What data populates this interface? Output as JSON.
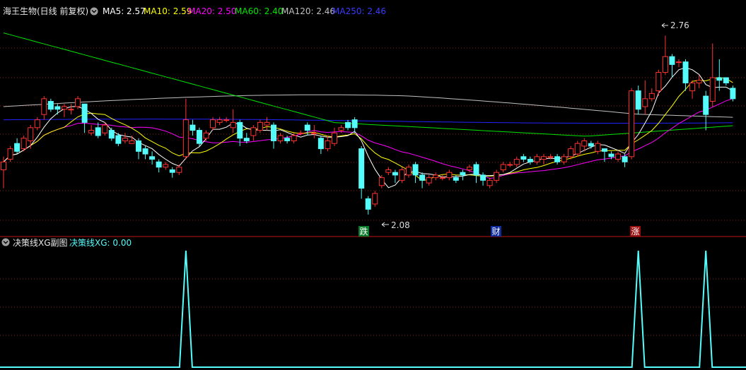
{
  "colors": {
    "up": "#ff3232",
    "down": "#54fcfc",
    "grid": "#8b1a1a",
    "ma5": "#ffffff",
    "ma10": "#ffff00",
    "ma20": "#ff00ff",
    "ma60": "#00e600",
    "ma120": "#c0c0c0",
    "ma250": "#2222ff",
    "xg": "#54fcfc"
  },
  "header": {
    "title": "海王生物(日线 前复权)",
    "menu_icon": "chevron-down-icon",
    "ma5": "MA5: 2.57",
    "ma10": "MA10: 2.59",
    "ma20": "MA20: 2.50",
    "ma60": "MA60: 2.40",
    "ma120": "MA120: 2.46",
    "ma250": "MA250: 2.46"
  },
  "annotations": {
    "high": "2.76",
    "low": "2.08",
    "signal_fall": "跌",
    "signal_wealth": "财",
    "signal_rise": "涨"
  },
  "sub": {
    "title": "决策线XG副图",
    "menu_icon": "chevron-down-icon",
    "value": "决策线XG: 0.00"
  },
  "chart_data": {
    "type": "candlestick",
    "ylim": [
      2.05,
      2.82
    ],
    "candles": [
      [
        2.25,
        2.28,
        2.18,
        2.3
      ],
      [
        2.29,
        2.33,
        2.28,
        2.34
      ],
      [
        2.35,
        2.32,
        2.31,
        2.37
      ],
      [
        2.33,
        2.37,
        2.32,
        2.38
      ],
      [
        2.36,
        2.41,
        2.33,
        2.42
      ],
      [
        2.41,
        2.44,
        2.4,
        2.45
      ],
      [
        2.46,
        2.52,
        2.44,
        2.53
      ],
      [
        2.51,
        2.48,
        2.47,
        2.52
      ],
      [
        2.49,
        2.48,
        2.46,
        2.5
      ],
      [
        2.48,
        2.49,
        2.45,
        2.5
      ],
      [
        2.48,
        2.48,
        2.46,
        2.5
      ],
      [
        2.49,
        2.52,
        2.48,
        2.53
      ],
      [
        2.5,
        2.43,
        2.39,
        2.5
      ],
      [
        2.39,
        2.4,
        2.38,
        2.42
      ],
      [
        2.41,
        2.38,
        2.37,
        2.43
      ],
      [
        2.39,
        2.42,
        2.38,
        2.43
      ],
      [
        2.4,
        2.37,
        2.36,
        2.41
      ],
      [
        2.38,
        2.35,
        2.34,
        2.39
      ],
      [
        2.36,
        2.37,
        2.35,
        2.39
      ],
      [
        2.35,
        2.36,
        2.35,
        2.38
      ],
      [
        2.36,
        2.32,
        2.29,
        2.37
      ],
      [
        2.33,
        2.31,
        2.29,
        2.34
      ],
      [
        2.3,
        2.29,
        2.27,
        2.32
      ],
      [
        2.28,
        2.26,
        2.24,
        2.29
      ],
      [
        2.26,
        2.27,
        2.25,
        2.28
      ],
      [
        2.25,
        2.24,
        2.22,
        2.26
      ],
      [
        2.24,
        2.26,
        2.23,
        2.27
      ],
      [
        2.3,
        2.44,
        2.29,
        2.52
      ],
      [
        2.42,
        2.4,
        2.38,
        2.44
      ],
      [
        2.4,
        2.35,
        2.34,
        2.41
      ],
      [
        2.37,
        2.39,
        2.36,
        2.4
      ],
      [
        2.41,
        2.44,
        2.4,
        2.45
      ],
      [
        2.43,
        2.44,
        2.42,
        2.45
      ],
      [
        2.44,
        2.44,
        2.43,
        2.45
      ],
      [
        2.41,
        2.43,
        2.39,
        2.48
      ],
      [
        2.43,
        2.37,
        2.34,
        2.44
      ],
      [
        2.37,
        2.36,
        2.35,
        2.39
      ],
      [
        2.38,
        2.41,
        2.36,
        2.42
      ],
      [
        2.4,
        2.43,
        2.39,
        2.44
      ],
      [
        2.42,
        2.43,
        2.4,
        2.45
      ],
      [
        2.42,
        2.36,
        2.33,
        2.43
      ],
      [
        2.36,
        2.38,
        2.35,
        2.39
      ],
      [
        2.37,
        2.36,
        2.35,
        2.38
      ],
      [
        2.36,
        2.38,
        2.35,
        2.39
      ],
      [
        2.39,
        2.39,
        2.38,
        2.4
      ],
      [
        2.42,
        2.4,
        2.38,
        2.43
      ],
      [
        2.39,
        2.39,
        2.37,
        2.42
      ],
      [
        2.37,
        2.33,
        2.31,
        2.38
      ],
      [
        2.33,
        2.36,
        2.32,
        2.38
      ],
      [
        2.35,
        2.39,
        2.34,
        2.41
      ],
      [
        2.4,
        2.41,
        2.39,
        2.42
      ],
      [
        2.43,
        2.41,
        2.4,
        2.44
      ],
      [
        2.44,
        2.41,
        2.39,
        2.45
      ],
      [
        2.33,
        2.18,
        2.14,
        2.34
      ],
      [
        2.14,
        2.1,
        2.08,
        2.15
      ],
      [
        2.12,
        2.16,
        2.11,
        2.17
      ],
      [
        2.19,
        2.22,
        2.18,
        2.23
      ],
      [
        2.24,
        2.25,
        2.23,
        2.26
      ],
      [
        2.24,
        2.23,
        2.2,
        2.25
      ],
      [
        2.21,
        2.25,
        2.2,
        2.26
      ],
      [
        2.23,
        2.26,
        2.22,
        2.27
      ],
      [
        2.27,
        2.23,
        2.2,
        2.28
      ],
      [
        2.23,
        2.21,
        2.18,
        2.24
      ],
      [
        2.2,
        2.22,
        2.19,
        2.23
      ],
      [
        2.22,
        2.23,
        2.21,
        2.24
      ],
      [
        2.22,
        2.22,
        2.21,
        2.23
      ],
      [
        2.22,
        2.24,
        2.21,
        2.25
      ],
      [
        2.22,
        2.21,
        2.2,
        2.23
      ],
      [
        2.24,
        2.23,
        2.21,
        2.25
      ],
      [
        2.25,
        2.26,
        2.24,
        2.27
      ],
      [
        2.27,
        2.23,
        2.2,
        2.28
      ],
      [
        2.23,
        2.21,
        2.19,
        2.24
      ],
      [
        2.19,
        2.21,
        2.18,
        2.22
      ],
      [
        2.21,
        2.24,
        2.2,
        2.25
      ],
      [
        2.25,
        2.27,
        2.24,
        2.28
      ],
      [
        2.27,
        2.27,
        2.26,
        2.28
      ],
      [
        2.27,
        2.29,
        2.26,
        2.3
      ],
      [
        2.3,
        2.29,
        2.28,
        2.31
      ],
      [
        2.29,
        2.28,
        2.27,
        2.3
      ],
      [
        2.28,
        2.3,
        2.27,
        2.31
      ],
      [
        2.29,
        2.3,
        2.27,
        2.31
      ],
      [
        2.3,
        2.3,
        2.29,
        2.31
      ],
      [
        2.3,
        2.28,
        2.27,
        2.31
      ],
      [
        2.28,
        2.3,
        2.27,
        2.31
      ],
      [
        2.3,
        2.33,
        2.29,
        2.34
      ],
      [
        2.31,
        2.35,
        2.3,
        2.36
      ],
      [
        2.34,
        2.36,
        2.32,
        2.37
      ],
      [
        2.35,
        2.34,
        2.33,
        2.36
      ],
      [
        2.32,
        2.35,
        2.31,
        2.36
      ],
      [
        2.33,
        2.32,
        2.28,
        2.33
      ],
      [
        2.31,
        2.3,
        2.29,
        2.32
      ],
      [
        2.29,
        2.31,
        2.28,
        2.32
      ],
      [
        2.3,
        2.28,
        2.26,
        2.31
      ],
      [
        2.3,
        2.55,
        2.29,
        2.56
      ],
      [
        2.55,
        2.48,
        2.46,
        2.57
      ],
      [
        2.49,
        2.52,
        2.46,
        2.59
      ],
      [
        2.52,
        2.54,
        2.51,
        2.56
      ],
      [
        2.55,
        2.62,
        2.53,
        2.63
      ],
      [
        2.62,
        2.68,
        2.61,
        2.76
      ],
      [
        2.68,
        2.65,
        2.6,
        2.69
      ],
      [
        2.66,
        2.66,
        2.64,
        2.67
      ],
      [
        2.66,
        2.58,
        2.55,
        2.67
      ],
      [
        2.55,
        2.58,
        2.52,
        2.59
      ],
      [
        2.58,
        2.59,
        2.56,
        2.61
      ],
      [
        2.53,
        2.46,
        2.4,
        2.55
      ],
      [
        2.51,
        2.6,
        2.49,
        2.73
      ],
      [
        2.6,
        2.59,
        2.55,
        2.67
      ],
      [
        2.6,
        2.58,
        2.57,
        2.6
      ],
      [
        2.56,
        2.52,
        2.51,
        2.57
      ]
    ],
    "xg_spikes": [
      27,
      94,
      104
    ]
  }
}
